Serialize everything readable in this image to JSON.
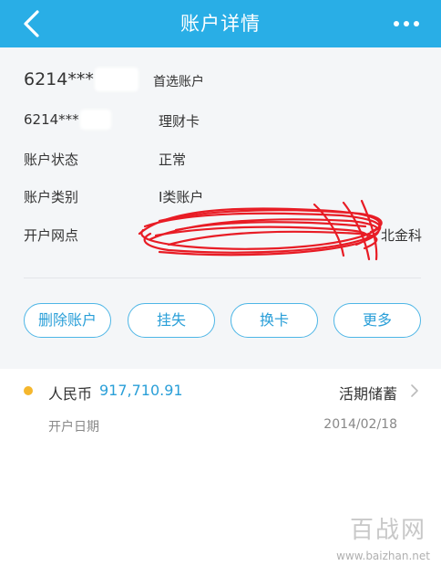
{
  "header": {
    "title": "账户详情",
    "back_icon": "chevron-left-icon",
    "more_icon": "more-dots-icon"
  },
  "account_info": {
    "card_number": "6214***",
    "card_tag": "首选账户",
    "sub_card_number": "6214***",
    "sub_card_type": "理财卡",
    "status_label": "账户状态",
    "status_value": "正常",
    "category_label": "账户类别",
    "category_value": "I类账户",
    "branch_label": "开户网点",
    "branch_value_tail": "北金科"
  },
  "actions": {
    "delete": "删除账户",
    "report_loss": "挂失",
    "replace_card": "换卡",
    "more": "更多"
  },
  "account_item": {
    "currency": "人民币",
    "amount": "917,710.91",
    "type": "活期储蓄",
    "date_label": "开户日期",
    "date_value": "2014/02/18"
  },
  "watermark": {
    "logo_text": "百战网",
    "url": "www.baizhan.net"
  },
  "colors": {
    "header_bg": "#29aee6",
    "accent": "#2a9fd8",
    "dot": "#f5b72d",
    "redaction_red": "#e8111a"
  }
}
